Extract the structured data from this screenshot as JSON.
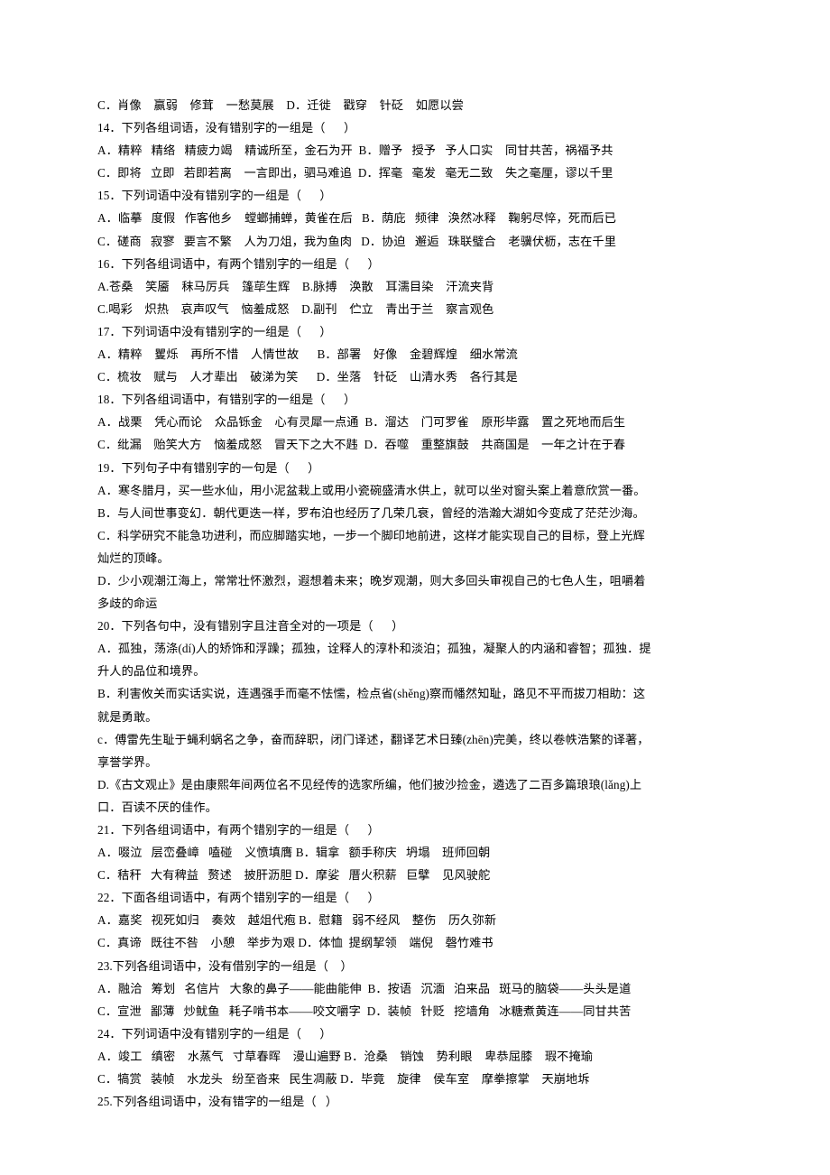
{
  "document": {
    "language": "zh-CN",
    "page_background": "#ffffff",
    "text_color": "#000000",
    "lines": [
      {
        "id": "q13-opt-cd",
        "kind": "option",
        "text": "C．肖像    赢弱    修茸    一愁莫展    D．迁徙    戳穿    针砭    如愿以尝"
      },
      {
        "id": "q14-stem",
        "kind": "stem",
        "text": "14．下列各组词语，没有错别字的一组是（      ）"
      },
      {
        "id": "q14-opt-ab",
        "kind": "option",
        "text": "A．精粹   精络   精疲力竭    精诚所至，金石为开  B．赠予   授予   予人口实    同甘共苦，祸福予共"
      },
      {
        "id": "q14-opt-cd",
        "kind": "option",
        "text": "C．即将   立即   若即若离    一言即出，驷马难追  D．挥毫   毫发   毫无二致    失之毫厘，谬以千里"
      },
      {
        "id": "q15-stem",
        "kind": "stem",
        "text": "15．下列词语中没有错别字的一组是（      ）"
      },
      {
        "id": "q15-opt-ab",
        "kind": "option",
        "text": "A．临摹   度假   作客他乡    螳螂捕蝉，黄雀在后   B．荫庇   频律   涣然冰释    鞠躬尽悴，死而后已"
      },
      {
        "id": "q15-opt-cd",
        "kind": "option",
        "text": "C．磋商   寂寥   要言不繁    人为刀俎，我为鱼肉   D．协迫   邂逅   珠联璧合    老骥伏枥，志在千里"
      },
      {
        "id": "q16-stem",
        "kind": "stem",
        "text": "16．下列各组词语中，有两个错别字的一组是（      ）"
      },
      {
        "id": "q16-opt-ab",
        "kind": "option",
        "text": "A.苍桑    笑靥    秣马厉兵    篷荜生辉    B.脉搏    涣散    耳濡目染    汗流夹背"
      },
      {
        "id": "q16-opt-cd",
        "kind": "option",
        "text": "C.喝彩    炽热    哀声叹气    恼羞成怒    D.副刊    伫立    青出于兰    察言观色"
      },
      {
        "id": "q17-stem",
        "kind": "stem",
        "text": "17．下列词语中没有错别字的一组是（      ）"
      },
      {
        "id": "q17-opt-ab",
        "kind": "option",
        "text": "A．精粹    矍烁    再所不惜    人情世故      B．部署    好像    金碧辉煌    细水常流"
      },
      {
        "id": "q17-opt-cd",
        "kind": "option",
        "text": "C．梳妆    赋与    人才辈出    破涕为笑      D．坐落    针砭    山清水秀    各行其是"
      },
      {
        "id": "q18-stem",
        "kind": "stem",
        "text": "18．下列各组词语中，有错别字的一组是（      ）"
      },
      {
        "id": "q18-opt-ab",
        "kind": "option",
        "text": "A．战栗    凭心而论    众品铄金    心有灵犀一点通  B．溜达    门可罗雀    原形毕露    置之死地而后生"
      },
      {
        "id": "q18-opt-cd",
        "kind": "option",
        "text": "C．纰漏    贻笑大方    恼羞成怒    冒天下之大不韪  D．吞噬    重整旗鼓    共商国是    一年之计在于春"
      },
      {
        "id": "q19-stem",
        "kind": "stem",
        "text": "19．下列句子中有错别字的一句是（      ）"
      },
      {
        "id": "q19-opt-a",
        "kind": "option",
        "text": "A．寒冬腊月，买一些水仙，用小泥盆栽上或用小瓷碗盛清水供上，就可以坐对窗头案上着意欣赏一番。"
      },
      {
        "id": "q19-opt-b",
        "kind": "option",
        "text": "B．与人间世事变幻．朝代更迭一样，罗布泊也经历了几荣几衰，曾经的浩瀚大湖如今变成了茫茫沙海。"
      },
      {
        "id": "q19-opt-c",
        "kind": "option",
        "text": "C．科学研究不能急功进利，而应脚踏实地，一步一个脚印地前进，这样才能实现自己的目标，登上光辉"
      },
      {
        "id": "q19-opt-c2",
        "kind": "cont",
        "text": "灿烂的顶峰。"
      },
      {
        "id": "q19-opt-d",
        "kind": "option",
        "text": "D．少小观潮江海上，常常壮怀激烈，遐想着未来；晚岁观潮，则大多回头审视自己的七色人生，咀嚼着"
      },
      {
        "id": "q19-opt-d2",
        "kind": "cont",
        "text": "多歧的命运"
      },
      {
        "id": "q20-stem",
        "kind": "stem",
        "text": "20．下列各句中，没有错别字且注音全对的一项是（      ）"
      },
      {
        "id": "q20-opt-a",
        "kind": "option",
        "text": "A．孤独，荡涤(dí)人的矫饰和浮躁；孤独，诠释人的淳朴和淡泊；孤独，凝聚人的内涵和睿智；孤独．提"
      },
      {
        "id": "q20-opt-a2",
        "kind": "cont",
        "text": "升人的品位和境界。"
      },
      {
        "id": "q20-opt-b",
        "kind": "option",
        "text": "B．利害攸关而实话实说，连遇强手而毫不怯懦，检点省(shěng)察而幡然知耻，路见不平而拔刀相助：这"
      },
      {
        "id": "q20-opt-b2",
        "kind": "cont",
        "text": "就是勇敢。"
      },
      {
        "id": "q20-opt-c",
        "kind": "option",
        "text": "c．傅雷先生耻于蝇利蜗名之争，奋而辞职，闭门译述，翻译艺术日臻(zhēn)完美，终以卷帙浩繁的译著，"
      },
      {
        "id": "q20-opt-c2",
        "kind": "cont",
        "text": "享誉学界。"
      },
      {
        "id": "q20-opt-d",
        "kind": "option",
        "text": "D.《古文观止》是由康熙年间两位名不见经传的选家所编，他们披沙捡金，遴选了二百多篇琅琅(lǎng)上"
      },
      {
        "id": "q20-opt-d2",
        "kind": "cont",
        "text": "口．百读不厌的佳作。"
      },
      {
        "id": "q21-stem",
        "kind": "stem",
        "text": "21．下列各组词语中，有两个错别字的一组是（      ）"
      },
      {
        "id": "q21-opt-ab",
        "kind": "option",
        "text": "A．啜泣   层峦叠嶂   嗑碰    义愤填膺 B．辑拿   额手称庆   坍塌    班师回朝"
      },
      {
        "id": "q21-opt-cd",
        "kind": "option",
        "text": "C．秸秆   大有稗益   赘述    披肝沥胆 D．摩娑   厝火积薪   巨擘    见风驶舵"
      },
      {
        "id": "q22-stem",
        "kind": "stem",
        "text": "22．下面各组词语中，有两个错别字的一组是（      ）"
      },
      {
        "id": "q22-opt-ab",
        "kind": "option",
        "text": "A．嘉奖   视死如归    奏效    越俎代疱 B．慰籍   弱不经风    整伤    历久弥新"
      },
      {
        "id": "q22-opt-cd",
        "kind": "option",
        "text": "C．真谛   既往不咎    小憩    举步为艰 D．体恤  提纲挈领    端倪    磬竹难书"
      },
      {
        "id": "q23-stem",
        "kind": "stem",
        "text": "23.下列各组词语中，没有借别字的一组是（    ）"
      },
      {
        "id": "q23-opt-ab",
        "kind": "option",
        "text": "A．融洽   筹划   名信片   大象的鼻子——能曲能伸  B．按语   沉湎   泊来品   斑马的脑袋——头头是道"
      },
      {
        "id": "q23-opt-cd",
        "kind": "option",
        "text": "C．宣泄   鄙薄   炒鱿鱼   耗子啃书本——咬文嚼字  D．装帧   针贬   挖墙角   冰糖煮黄连——同甘共苦"
      },
      {
        "id": "q24-stem",
        "kind": "stem",
        "text": "24．下列词语中没有错别字的一组是（      ）"
      },
      {
        "id": "q24-opt-ab",
        "kind": "option",
        "text": "A．竣工   缜密    水蒸气   寸草春晖    漫山遍野 B．沧桑    销蚀    势利眼    卑恭屈膝    瑕不掩瑜"
      },
      {
        "id": "q24-opt-cd",
        "kind": "option",
        "text": "C．犒赏   装帧    水龙头   纷至沓来   民生凋蔽 D．毕竟    旋律    侯车室    摩拳擦掌    天崩地坼"
      },
      {
        "id": "q25-stem",
        "kind": "stem",
        "text": "25.下列各组词语中，没有错字的一组是（   ）"
      }
    ]
  }
}
